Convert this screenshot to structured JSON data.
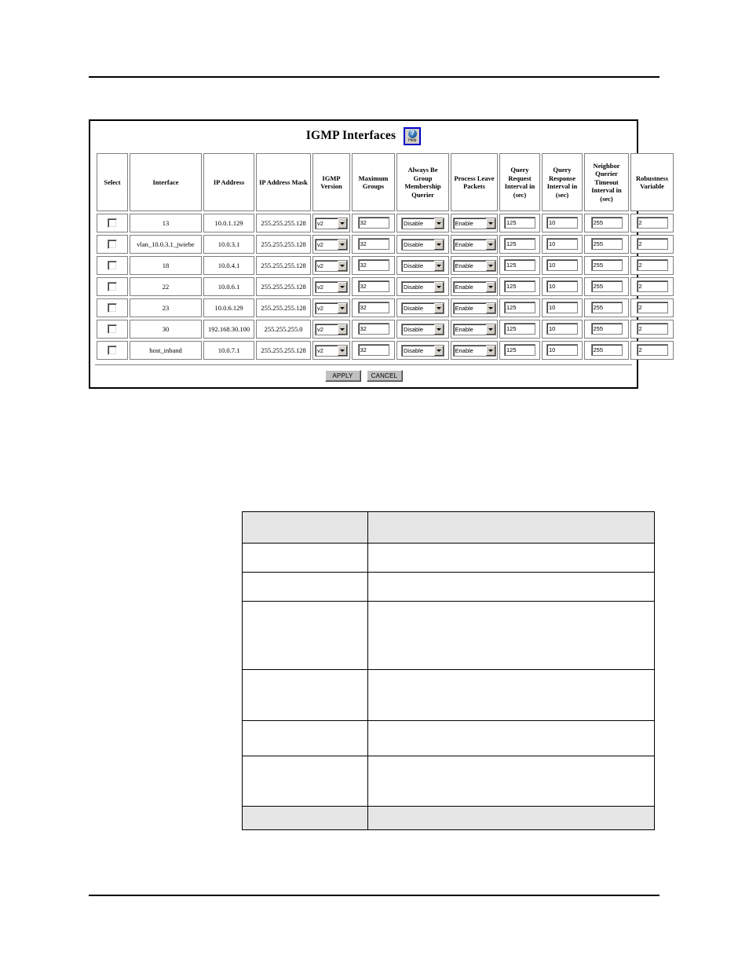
{
  "page": {
    "rules": {
      "top": "horizontal-rule",
      "bottom": "horizontal-rule"
    }
  },
  "app_panel": {
    "title": "IGMP Interfaces",
    "help_button": {
      "icon": "help-globe-icon",
      "label": "Help"
    },
    "table": {
      "columns": [
        "Select",
        "Interface",
        "IP Address",
        "IP Address Mask",
        "IGMP Version",
        "Maximum Groups",
        "Always Be Group Membership Querier",
        "Process Leave Packets",
        "Query Request Interval in (sec)",
        "Query Response Interval in (sec)",
        "Neighbor Querier Timeout Interval in (sec)",
        "Robustness Variable"
      ],
      "rows": [
        {
          "select": false,
          "interface": "13",
          "ip_address": "10.0.1.129",
          "ip_address_mask": "255.255.255.128",
          "igmp_version": "v2",
          "maximum_groups": "32",
          "always_be_querier": "Disable",
          "process_leave_packets": "Enable",
          "query_request_interval": "125",
          "query_response_interval": "10",
          "neighbor_querier_timeout": "255",
          "robustness_variable": "2"
        },
        {
          "select": false,
          "interface": "vlan_10.0.3.1_jwiebe",
          "ip_address": "10.0.3.1",
          "ip_address_mask": "255.255.255.128",
          "igmp_version": "v2",
          "maximum_groups": "32",
          "always_be_querier": "Disable",
          "process_leave_packets": "Enable",
          "query_request_interval": "125",
          "query_response_interval": "10",
          "neighbor_querier_timeout": "255",
          "robustness_variable": "2"
        },
        {
          "select": false,
          "interface": "18",
          "ip_address": "10.0.4.1",
          "ip_address_mask": "255.255.255.128",
          "igmp_version": "v2",
          "maximum_groups": "32",
          "always_be_querier": "Disable",
          "process_leave_packets": "Enable",
          "query_request_interval": "125",
          "query_response_interval": "10",
          "neighbor_querier_timeout": "255",
          "robustness_variable": "2"
        },
        {
          "select": false,
          "interface": "22",
          "ip_address": "10.0.6.1",
          "ip_address_mask": "255.255.255.128",
          "igmp_version": "v2",
          "maximum_groups": "32",
          "always_be_querier": "Disable",
          "process_leave_packets": "Enable",
          "query_request_interval": "125",
          "query_response_interval": "10",
          "neighbor_querier_timeout": "255",
          "robustness_variable": "2"
        },
        {
          "select": false,
          "interface": "23",
          "ip_address": "10.0.6.129",
          "ip_address_mask": "255.255.255.128",
          "igmp_version": "v2",
          "maximum_groups": "32",
          "always_be_querier": "Disable",
          "process_leave_packets": "Enable",
          "query_request_interval": "125",
          "query_response_interval": "10",
          "neighbor_querier_timeout": "255",
          "robustness_variable": "2"
        },
        {
          "select": false,
          "interface": "30",
          "ip_address": "192.168.30.100",
          "ip_address_mask": "255.255.255.0",
          "igmp_version": "v2",
          "maximum_groups": "32",
          "always_be_querier": "Disable",
          "process_leave_packets": "Enable",
          "query_request_interval": "125",
          "query_response_interval": "10",
          "neighbor_querier_timeout": "255",
          "robustness_variable": "2"
        },
        {
          "select": false,
          "interface": "host_inband",
          "ip_address": "10.0.7.1",
          "ip_address_mask": "255.255.255.128",
          "igmp_version": "v2",
          "maximum_groups": "32",
          "always_be_querier": "Disable",
          "process_leave_packets": "Enable",
          "query_request_interval": "125",
          "query_response_interval": "10",
          "neighbor_querier_timeout": "255",
          "robustness_variable": "2"
        }
      ]
    },
    "buttons": {
      "apply": "APPLY",
      "cancel": "CANCEL"
    }
  },
  "reference_table": {
    "header": {
      "col_a": "",
      "col_b": ""
    },
    "rows": [
      {
        "col_a": "",
        "col_b": ""
      },
      {
        "col_a": "",
        "col_b": ""
      },
      {
        "col_a": "",
        "col_b": ""
      },
      {
        "col_a": "",
        "col_b": ""
      },
      {
        "col_a": "",
        "col_b": ""
      },
      {
        "col_a": "",
        "col_b": ""
      }
    ],
    "footer": ""
  }
}
